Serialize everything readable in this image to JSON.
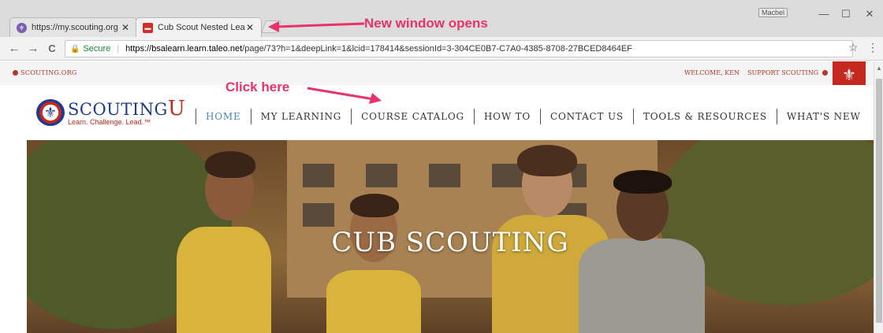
{
  "browser": {
    "tabs": [
      {
        "title": "https://my.scouting.org",
        "close": "✕"
      },
      {
        "title": "Cub Scout Nested Learni",
        "close": "✕"
      }
    ],
    "profile": "Macbel",
    "window_controls": {
      "minimize": "—",
      "maximize": "☐",
      "close": "✕"
    },
    "nav": {
      "back": "←",
      "forward": "→",
      "reload": "C"
    },
    "secure_label": "Secure",
    "url_host": "https://bsalearn.learn.taleo.net",
    "url_path": "/page/73?h=1&deepLink=1&lcid=178414&sessionId=3-304CE0B7-C7A0-4385-8708-27BCED8464EF",
    "star": "☆",
    "menu": "⋮"
  },
  "site": {
    "utility_left": "SCOUTING.ORG",
    "welcome": "WELCOME, KEN",
    "support": "SUPPORT SCOUTING",
    "logo": {
      "brand": "SCOUTING",
      "brand_u": "U",
      "tagline": "Learn. Challenge. Lead.™"
    },
    "nav": [
      {
        "label": "HOME"
      },
      {
        "label": "MY LEARNING"
      },
      {
        "label": "COURSE CATALOG"
      },
      {
        "label": "HOW TO"
      },
      {
        "label": "CONTACT US"
      },
      {
        "label": "TOOLS & RESOURCES"
      },
      {
        "label": "WHAT'S NEW"
      }
    ],
    "hero_title": "CUB SCOUTING"
  },
  "annotations": {
    "new_window": "New window opens",
    "click_here": "Click here",
    "color": "#e8336a"
  },
  "colors": {
    "brand_blue": "#1d3a8f",
    "brand_red": "#c4281f",
    "nav_active": "#4a86b8"
  }
}
